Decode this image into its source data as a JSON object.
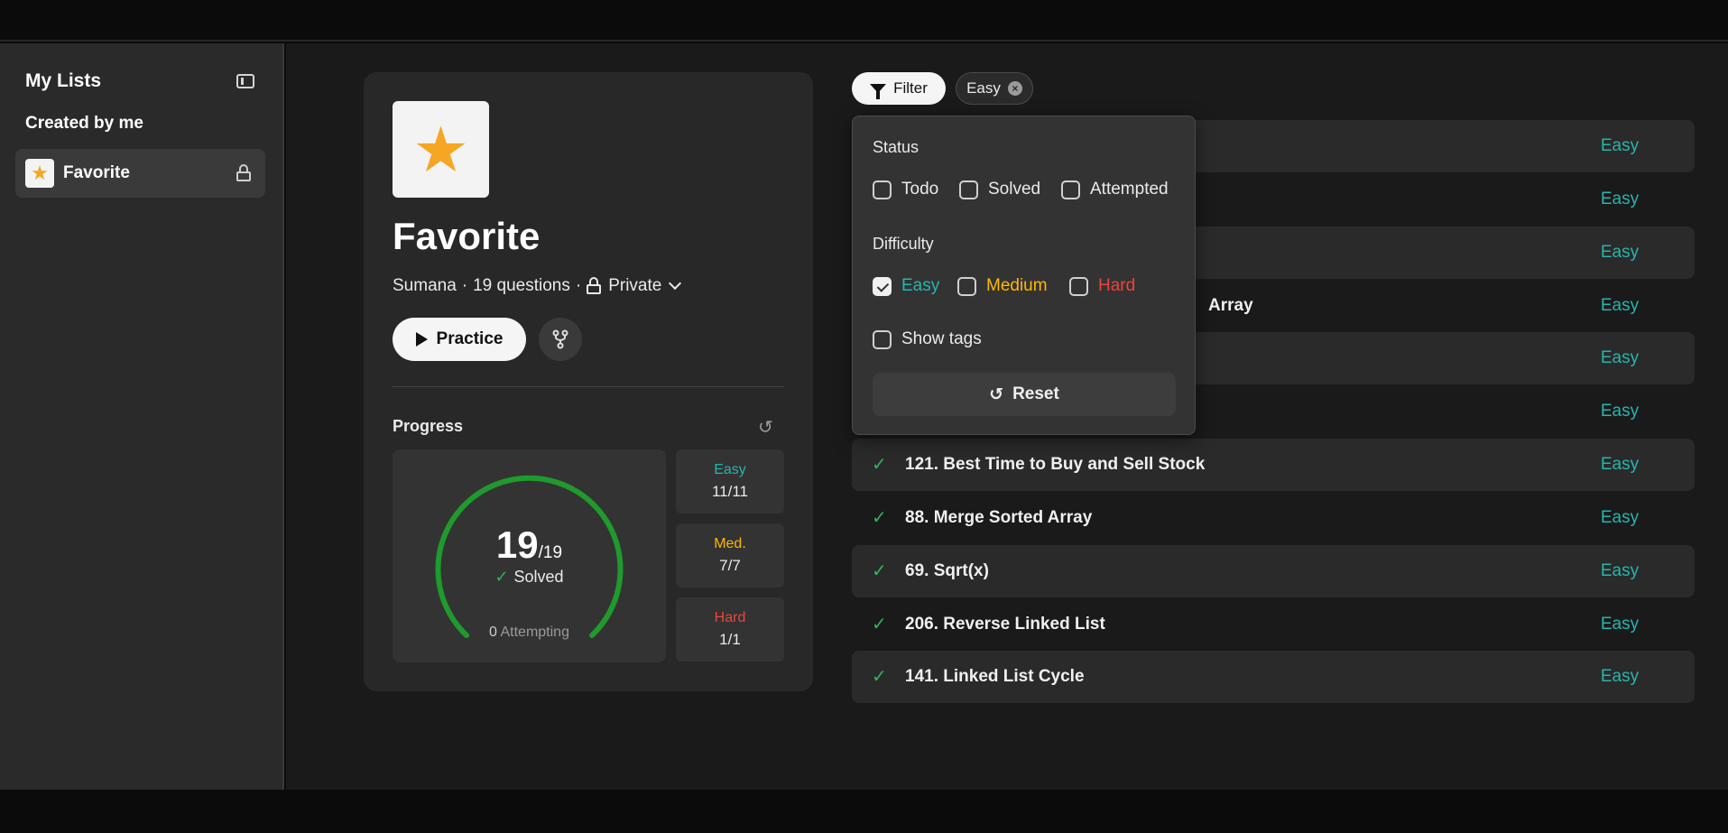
{
  "sidebar": {
    "title": "My Lists",
    "section": "Created by me",
    "items": [
      {
        "label": "Favorite",
        "icon": "star-icon",
        "locked": true
      }
    ]
  },
  "list": {
    "title": "Favorite",
    "owner": "Sumana",
    "count": "19 questions",
    "visibility": "Private",
    "practice_label": "Practice"
  },
  "progress": {
    "label": "Progress",
    "solved": "19",
    "total": "/19",
    "solved_label": "Solved",
    "attempting_count": "0",
    "attempting_label": "Attempting",
    "stats": [
      {
        "key": "Easy",
        "value": "11/11",
        "color": "#27b5ad"
      },
      {
        "key": "Med.",
        "value": "7/7",
        "color": "#ffb800"
      },
      {
        "key": "Hard",
        "value": "1/1",
        "color": "#f0433c"
      }
    ]
  },
  "filter": {
    "button_label": "Filter",
    "active_chip": "Easy",
    "status_header": "Status",
    "status_options": [
      "Todo",
      "Solved",
      "Attempted"
    ],
    "difficulty_header": "Difficulty",
    "difficulty_options": [
      {
        "label": "Easy",
        "checked": true,
        "color": "#27b5ad"
      },
      {
        "label": "Medium",
        "checked": false,
        "color": "#ffb800"
      },
      {
        "label": "Hard",
        "checked": false,
        "color": "#f0433c"
      }
    ],
    "show_tags": "Show tags",
    "reset_label": "Reset"
  },
  "problems": [
    {
      "title": "",
      "difficulty": "Easy"
    },
    {
      "title": "",
      "difficulty": "Easy"
    },
    {
      "title": "",
      "difficulty": "Easy"
    },
    {
      "title": "Array",
      "difficulty": "Easy"
    },
    {
      "title": "",
      "difficulty": "Easy"
    },
    {
      "title": "",
      "difficulty": "Easy"
    },
    {
      "title": "121. Best Time to Buy and Sell Stock",
      "difficulty": "Easy"
    },
    {
      "title": "88. Merge Sorted Array",
      "difficulty": "Easy"
    },
    {
      "title": "69. Sqrt(x)",
      "difficulty": "Easy"
    },
    {
      "title": "206. Reverse Linked List",
      "difficulty": "Easy"
    },
    {
      "title": "141. Linked List Cycle",
      "difficulty": "Easy"
    }
  ],
  "colors": {
    "accent_green": "#2db55d",
    "easy": "#27b5ad",
    "medium": "#ffb800",
    "hard": "#f0433c"
  }
}
